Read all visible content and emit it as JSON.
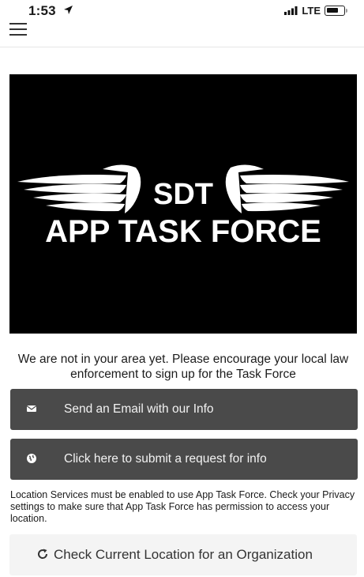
{
  "status_bar": {
    "time": "1:53",
    "carrier": "LTE",
    "icons": [
      "location-arrow-icon",
      "signal-icon",
      "battery-icon"
    ]
  },
  "header": {
    "menu_icon": "hamburger-icon"
  },
  "banner": {
    "logo_text_top": "SDT",
    "logo_text_bottom": "APP TASK FORCE",
    "background_color": "#000000"
  },
  "message": "We are not in your area yet. Please encourage your local law enforcement to sign up for the Task Force",
  "actions": [
    {
      "icon": "envelope-icon",
      "label": "Send an Email with our Info"
    },
    {
      "icon": "globe-icon",
      "label": "Click here to submit a request for info"
    }
  ],
  "notice": "Location Services must be enabled to use App Task Force. Check your Privacy settings to make sure that App Task Force has permission to access your location.",
  "check_location": {
    "icon": "refresh-icon",
    "label": "Check Current Location for an Organization"
  },
  "colors": {
    "button_dark": "#4a4a4a",
    "button_light": "#f4f4f4",
    "banner": "#000000"
  }
}
